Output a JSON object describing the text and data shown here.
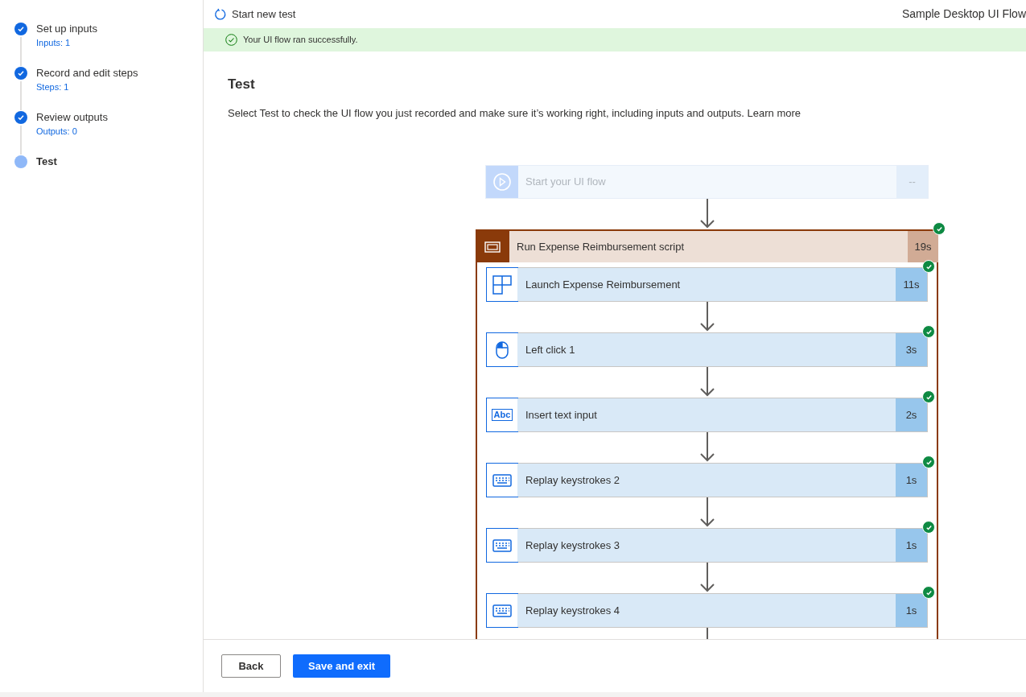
{
  "wizard_steps": [
    {
      "label": "Set up inputs",
      "detail": "Inputs: 1",
      "done": true
    },
    {
      "label": "Record and edit steps",
      "detail": "Steps: 1",
      "done": true
    },
    {
      "label": "Review outputs",
      "detail": "Outputs: 0",
      "done": true
    },
    {
      "label": "Test",
      "done": false
    }
  ],
  "header": {
    "action": "Start new test",
    "flow_name": "Sample Desktop UI Flow"
  },
  "banner": {
    "message": "Your UI flow ran successfully."
  },
  "page": {
    "title": "Test",
    "description": "Select Test to check the UI flow you just recorded and make sure it’s working right, including inputs and outputs.",
    "link": "Learn more"
  },
  "trigger": {
    "label": "Start your UI flow",
    "duration": "--"
  },
  "scope": {
    "label": "Run Expense Reimbursement script",
    "duration": "19s",
    "succeeded": true,
    "steps": [
      {
        "kind": "launch",
        "label": "Launch Expense Reimbursement",
        "duration": "11s",
        "succeeded": true
      },
      {
        "kind": "click",
        "label": "Left click 1",
        "duration": "3s",
        "succeeded": true
      },
      {
        "kind": "text",
        "icon_label": "Abc",
        "label": "Insert text input",
        "duration": "2s",
        "succeeded": true
      },
      {
        "kind": "keys",
        "label": "Replay keystrokes 2",
        "duration": "1s",
        "succeeded": true
      },
      {
        "kind": "keys",
        "label": "Replay keystrokes 3",
        "duration": "1s",
        "succeeded": true
      },
      {
        "kind": "keys",
        "label": "Replay keystrokes 4",
        "duration": "1s",
        "succeeded": true
      }
    ]
  },
  "footer": {
    "buttons": [
      {
        "label": "Back",
        "primary": false
      },
      {
        "label": "Save and exit",
        "primary": true
      }
    ]
  }
}
